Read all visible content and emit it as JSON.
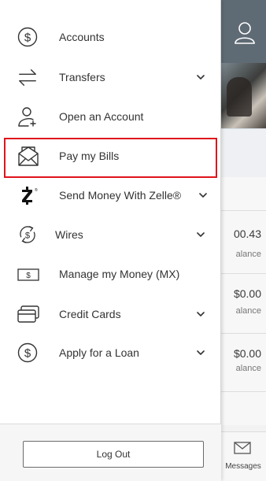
{
  "menu": {
    "items": [
      {
        "label": "Accounts",
        "icon": "dollar-circle-icon",
        "has_chevron": false
      },
      {
        "label": "Transfers",
        "icon": "transfer-arrows-icon",
        "has_chevron": true
      },
      {
        "label": "Open an Account",
        "icon": "add-user-icon",
        "has_chevron": false
      },
      {
        "label": "Pay my Bills",
        "icon": "envelope-icon",
        "has_chevron": false,
        "selected": true
      },
      {
        "label": "Send Money With Zelle®",
        "icon": "zelle-icon",
        "has_chevron": true
      },
      {
        "label": "Wires",
        "icon": "wire-cycle-icon",
        "has_chevron": true
      },
      {
        "label": "Manage my Money (MX)",
        "icon": "money-bill-icon",
        "has_chevron": false
      },
      {
        "label": "Credit Cards",
        "icon": "credit-card-icon",
        "has_chevron": true
      },
      {
        "label": "Apply for a Loan",
        "icon": "dollar-circle-icon",
        "has_chevron": true
      }
    ]
  },
  "footer": {
    "logout_label": "Log Out"
  },
  "background": {
    "accounts": [
      {
        "amount": "00.43",
        "sub": "alance"
      },
      {
        "amount": "$0.00",
        "sub": "alance"
      },
      {
        "amount": "$0.00",
        "sub": "alance"
      }
    ],
    "messages_label": "Messages"
  },
  "colors": {
    "accent_selected": "#e0131b",
    "header_bg": "#5f6b74"
  }
}
